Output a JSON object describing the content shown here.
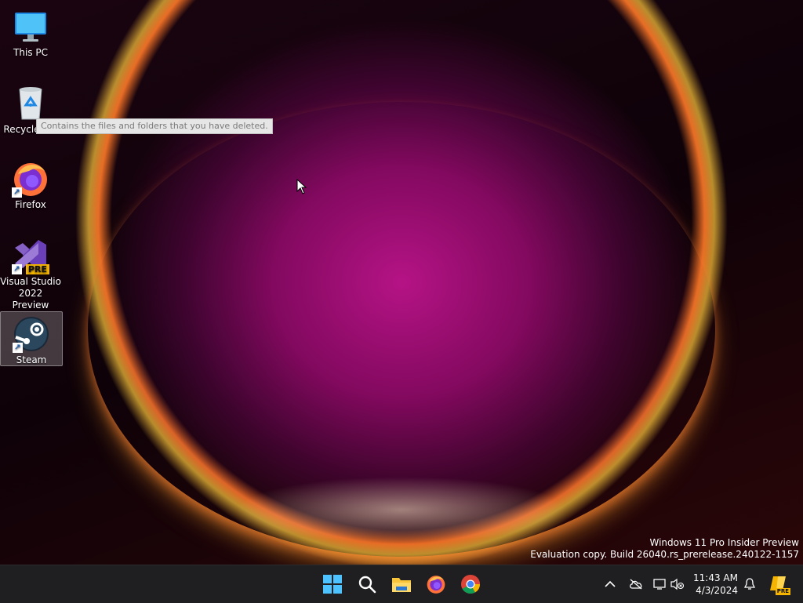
{
  "desktop": {
    "icons": [
      {
        "label": "This PC",
        "icon": "this-pc-icon",
        "selected": false
      },
      {
        "label": "Recycle Bin",
        "icon": "recycle-bin-icon",
        "selected": false
      },
      {
        "label": "Firefox",
        "icon": "firefox-icon",
        "selected": false
      },
      {
        "label": "Visual Studio 2022 Preview",
        "icon": "visual-studio-icon",
        "badge": "PRE",
        "selected": false
      },
      {
        "label": "Steam",
        "icon": "steam-icon",
        "selected": true
      }
    ],
    "tooltip": "Contains the files and folders that you have deleted.",
    "watermark": {
      "line1": "Windows 11 Pro Insider Preview",
      "line2": "Evaluation copy. Build 26040.rs_prerelease.240122-1157"
    }
  },
  "taskbar": {
    "apps": [
      "start-icon",
      "search-icon",
      "file-explorer-icon",
      "firefox-icon",
      "chrome-icon"
    ],
    "tray": [
      "chevron-up-icon",
      "cloud-offline-icon",
      "display-icon",
      "volume-muted-icon"
    ],
    "clock": {
      "time": "11:43 AM",
      "date": "4/3/2024"
    },
    "copilot_badge": "PRE"
  },
  "colors": {
    "taskbar_bg": "#1f1f21",
    "accent": "#0078d4"
  }
}
